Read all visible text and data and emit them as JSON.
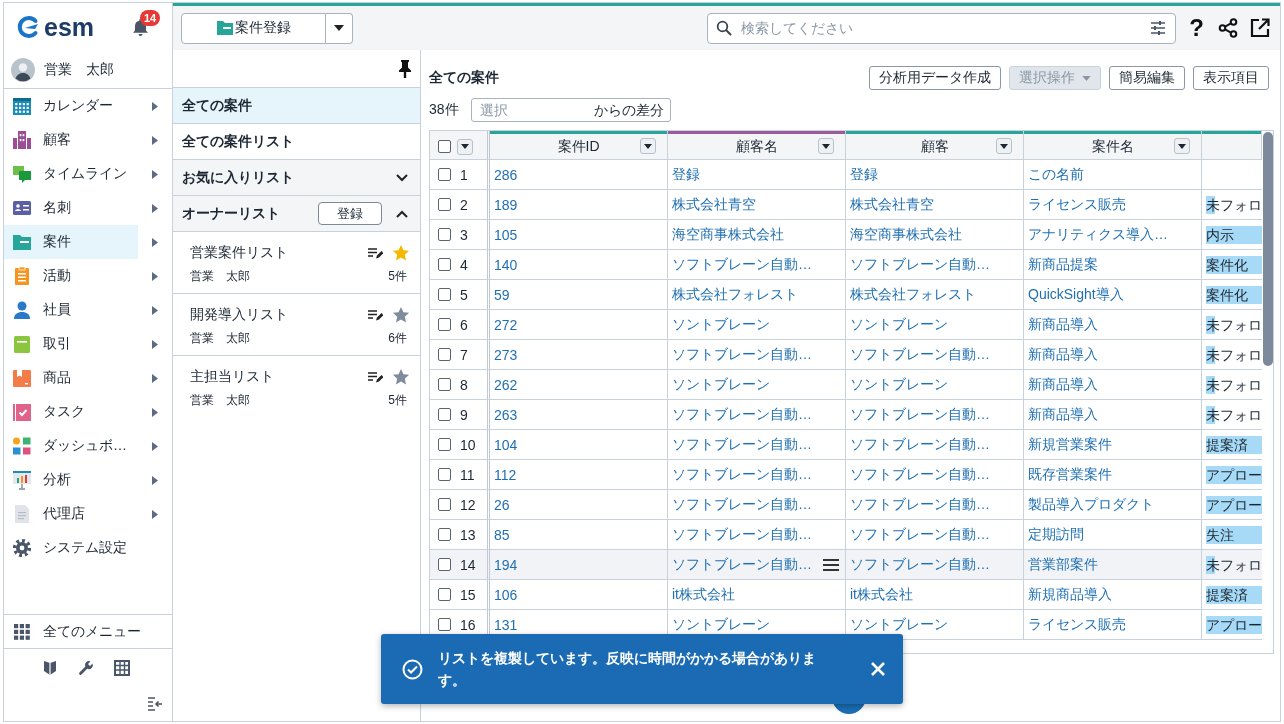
{
  "sidebar": {
    "logo": "esm",
    "notifications": "14",
    "user": "営業　太郎",
    "items": [
      {
        "label": "カレンダー",
        "selected": false,
        "submenu": true
      },
      {
        "label": "顧客",
        "selected": false,
        "submenu": true
      },
      {
        "label": "タイムライン",
        "selected": false,
        "submenu": true
      },
      {
        "label": "名刺",
        "selected": false,
        "submenu": true
      },
      {
        "label": "案件",
        "selected": true,
        "submenu": true
      },
      {
        "label": "活動",
        "selected": false,
        "submenu": true
      },
      {
        "label": "社員",
        "selected": false,
        "submenu": true
      },
      {
        "label": "取引",
        "selected": false,
        "submenu": true
      },
      {
        "label": "商品",
        "selected": false,
        "submenu": true
      },
      {
        "label": "タスク",
        "selected": false,
        "submenu": true
      },
      {
        "label": "ダッシュボ…",
        "selected": false,
        "submenu": true
      },
      {
        "label": "分析",
        "selected": false,
        "submenu": true
      },
      {
        "label": "代理店",
        "selected": false,
        "submenu": true
      },
      {
        "label": "システム設定",
        "selected": false,
        "submenu": false
      }
    ],
    "all_menu": "全てのメニュー"
  },
  "toolbar": {
    "new_button": "案件登録",
    "search": {
      "placeholder": "検索してください"
    },
    "help": "?"
  },
  "list_panel": {
    "views": [
      {
        "label": "全ての案件",
        "selected": true
      },
      {
        "label": "全ての案件リスト",
        "selected": false
      }
    ],
    "sections": [
      {
        "title": "お気に入りリスト",
        "expanded": false
      },
      {
        "title": "オーナーリスト",
        "expanded": true,
        "button": "登録",
        "lists": [
          {
            "name": "営業案件リスト",
            "owner": "営業　太郎",
            "count": "5件",
            "favorite": true
          },
          {
            "name": "開発導入リスト",
            "owner": "営業　太郎",
            "count": "6件",
            "favorite": false
          },
          {
            "name": "主担当リスト",
            "owner": "営業　太郎",
            "count": "5件",
            "favorite": false
          }
        ]
      }
    ]
  },
  "content": {
    "title": "全ての案件",
    "buttons": [
      {
        "label": "分析用データ作成",
        "kind": "plain",
        "disabled": false
      },
      {
        "label": "選択操作",
        "kind": "dropdown",
        "disabled": true
      },
      {
        "label": "簡易編集",
        "kind": "plain",
        "disabled": false
      },
      {
        "label": "表示項目",
        "kind": "plain",
        "disabled": false
      }
    ],
    "count": "38件",
    "diff_filter": {
      "placeholder": "選択",
      "suffix": "からの差分"
    },
    "table": {
      "header_checked": false,
      "columns": [
        {
          "label": "案件ID",
          "color": "#26a69a"
        },
        {
          "label": "顧客名",
          "color": "#9c5b9e"
        },
        {
          "label": "顧客",
          "color": "#26a69a"
        },
        {
          "label": "案件名",
          "color": "#26a69a"
        },
        {
          "color": "#26a69a"
        }
      ],
      "rows": [
        {
          "number": "1",
          "checked": false,
          "hovered": false,
          "cells": [
            "286",
            "登録",
            "登録",
            "この名前"
          ]
        },
        {
          "number": "2",
          "checked": false,
          "hovered": false,
          "cells": [
            "189",
            "株式会社青空",
            "株式会社青空",
            "ライセンス販売"
          ],
          "stage": {
            "text": "未フォロ",
            "kind": "short"
          }
        },
        {
          "number": "3",
          "checked": false,
          "hovered": false,
          "cells": [
            "105",
            "海空商事株式会社",
            "海空商事株式会社",
            "アナリティクス導入…"
          ],
          "stage": {
            "text": "内示",
            "kind": "full"
          }
        },
        {
          "number": "4",
          "checked": false,
          "hovered": false,
          "cells": [
            "140",
            "ソフトブレーン自動…",
            "ソフトブレーン自動…",
            "新商品提案"
          ],
          "stage": {
            "text": "案件化",
            "kind": "full"
          }
        },
        {
          "number": "5",
          "checked": false,
          "hovered": false,
          "cells": [
            "59",
            "株式会社フォレスト",
            "株式会社フォレスト",
            "QuickSight導入"
          ],
          "stage": {
            "text": "案件化",
            "kind": "full"
          }
        },
        {
          "number": "6",
          "checked": false,
          "hovered": false,
          "cells": [
            "272",
            "ソントブレーン",
            "ソントブレーン",
            "新商品導入"
          ],
          "stage": {
            "text": "未フォロ",
            "kind": "short"
          }
        },
        {
          "number": "7",
          "checked": false,
          "hovered": false,
          "cells": [
            "273",
            "ソフトブレーン自動…",
            "ソフトブレーン自動…",
            "新商品導入"
          ],
          "stage": {
            "text": "未フォロ",
            "kind": "short"
          }
        },
        {
          "number": "8",
          "checked": false,
          "hovered": false,
          "cells": [
            "262",
            "ソントブレーン",
            "ソントブレーン",
            "新商品導入"
          ],
          "stage": {
            "text": "未フォロ",
            "kind": "short"
          }
        },
        {
          "number": "9",
          "checked": false,
          "hovered": false,
          "cells": [
            "263",
            "ソフトブレーン自動…",
            "ソフトブレーン自動…",
            "新商品導入"
          ],
          "stage": {
            "text": "未フォロ",
            "kind": "short"
          }
        },
        {
          "number": "10",
          "checked": false,
          "hovered": false,
          "cells": [
            "104",
            "ソフトブレーン自動…",
            "ソフトブレーン自動…",
            "新規営業案件"
          ],
          "stage": {
            "text": "提案済",
            "kind": "full"
          }
        },
        {
          "number": "11",
          "checked": false,
          "hovered": false,
          "cells": [
            "112",
            "ソフトブレーン自動…",
            "ソフトブレーン自動…",
            "既存営業案件"
          ],
          "stage": {
            "text": "アプロー",
            "kind": "full"
          }
        },
        {
          "number": "12",
          "checked": false,
          "hovered": false,
          "cells": [
            "26",
            "ソフトブレーン自動…",
            "ソフトブレーン自動…",
            "製品導入プロダクト"
          ],
          "stage": {
            "text": "アプロー",
            "kind": "full"
          }
        },
        {
          "number": "13",
          "checked": false,
          "hovered": false,
          "cells": [
            "85",
            "ソフトブレーン自動…",
            "ソフトブレーン自動…",
            "定期訪問"
          ],
          "stage": {
            "text": "失注",
            "kind": "full"
          }
        },
        {
          "number": "14",
          "checked": false,
          "hovered": true,
          "cells": [
            "194",
            "ソフトブレーン自動…",
            "ソフトブレーン自動…",
            "営業部案件"
          ],
          "stage": {
            "text": "未フォロ",
            "kind": "short"
          }
        },
        {
          "number": "15",
          "checked": false,
          "hovered": false,
          "cells": [
            "106",
            "it株式会社",
            "it株式会社",
            "新規商品導入"
          ],
          "stage": {
            "text": "提案済",
            "kind": "full"
          }
        },
        {
          "number": "16",
          "checked": false,
          "hovered": false,
          "cells": [
            "131",
            "ソントブレーン",
            "ソントブレーン",
            "ライセンス販売"
          ],
          "stage": {
            "text": "アプロー",
            "kind": "full"
          }
        }
      ]
    }
  },
  "toast": {
    "message": "リストを複製しています。反映に時間がかかる場合があります。"
  }
}
